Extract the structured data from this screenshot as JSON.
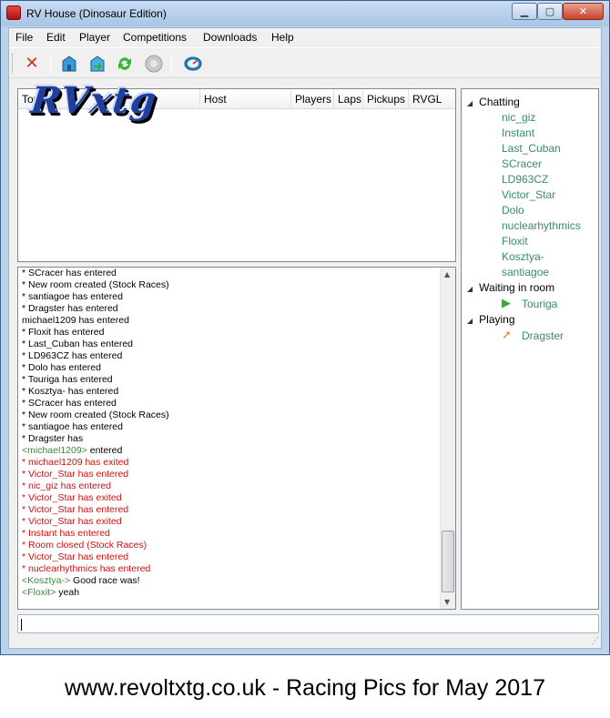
{
  "window": {
    "title": "RV House (Dinosaur Edition)",
    "min": "▁",
    "max": "▢",
    "close": "✕"
  },
  "menu": [
    "File",
    "Edit",
    "Player",
    "Competitions",
    "Downloads",
    "Help"
  ],
  "toolbar_icons": [
    "disconnect-icon",
    "host-room-icon",
    "join-room-icon",
    "refresh-icon",
    "disabled-icon",
    "speed-icon"
  ],
  "room_columns": [
    "Topic",
    "Host",
    "Players",
    "Laps",
    "Pickups",
    "RVGL"
  ],
  "logo_text": "RVxtg",
  "chat": [
    {
      "text": "* SCracer has entered",
      "style": "normal"
    },
    {
      "text": "* New room created (Stock Races)",
      "style": "normal"
    },
    {
      "text": "* santiagoe has entered",
      "style": "normal"
    },
    {
      "text": "* Dragster has entered",
      "style": "normal"
    },
    {
      "text": "michael1209 has entered",
      "style": "normal"
    },
    {
      "text": "* Floxit has entered",
      "style": "normal"
    },
    {
      "text": "* Last_Cuban has entered",
      "style": "normal"
    },
    {
      "text": "* LD963CZ has entered",
      "style": "normal"
    },
    {
      "text": "* Dolo has entered",
      "style": "normal"
    },
    {
      "text": "* Touriga has entered",
      "style": "normal"
    },
    {
      "text": "* Kosztya- has entered",
      "style": "normal"
    },
    {
      "text": "* SCracer has entered",
      "style": "normal"
    },
    {
      "text": "* New room created (Stock Races)",
      "style": "normal"
    },
    {
      "text": "* santiagoe has entered",
      "style": "normal"
    },
    {
      "text": "* Dragster has",
      "style": "normal"
    },
    {
      "text": "<michael1209> entered",
      "style": "user",
      "nick": "<michael1209>",
      "msg": " entered"
    },
    {
      "text": "* michael1209 has exited",
      "style": "red"
    },
    {
      "text": "* Victor_Star has entered",
      "style": "red"
    },
    {
      "text": "* nic_giz has entered",
      "style": "red"
    },
    {
      "text": "* Victor_Star has exited",
      "style": "red"
    },
    {
      "text": "* Victor_Star has entered",
      "style": "red"
    },
    {
      "text": "* Victor_Star has exited",
      "style": "red"
    },
    {
      "text": "* Instant has entered",
      "style": "red"
    },
    {
      "text": "* Room closed (Stock Races)",
      "style": "red"
    },
    {
      "text": "* Victor_Star has entered",
      "style": "red"
    },
    {
      "text": "* nuclearhythmics has entered",
      "style": "red"
    },
    {
      "text": "<Kosztya-> Good race was!",
      "style": "user",
      "nick": "<Kosztya->",
      "msg": " Good race was!"
    },
    {
      "text": "<Floxit> yeah",
      "style": "user",
      "nick": "<Floxit>",
      "msg": " yeah"
    }
  ],
  "users": {
    "chatting_label": "Chatting",
    "chatting": [
      "nic_giz",
      "Instant",
      "Last_Cuban",
      "SCracer",
      "LD963CZ",
      "Victor_Star",
      "Dolo",
      "nuclearhythmics",
      "Floxit",
      "Kosztya-",
      "santiagoe"
    ],
    "waiting_label": "Waiting in room",
    "waiting": [
      "Touriga"
    ],
    "playing_label": "Playing",
    "playing": [
      "Dragster"
    ]
  },
  "footer": "www.revoltxtg.co.uk - Racing Pics for May 2017",
  "colors": {
    "system_msg": "#d01010",
    "nick": "#3a8a3a",
    "user_list": "#3a8a6a"
  }
}
